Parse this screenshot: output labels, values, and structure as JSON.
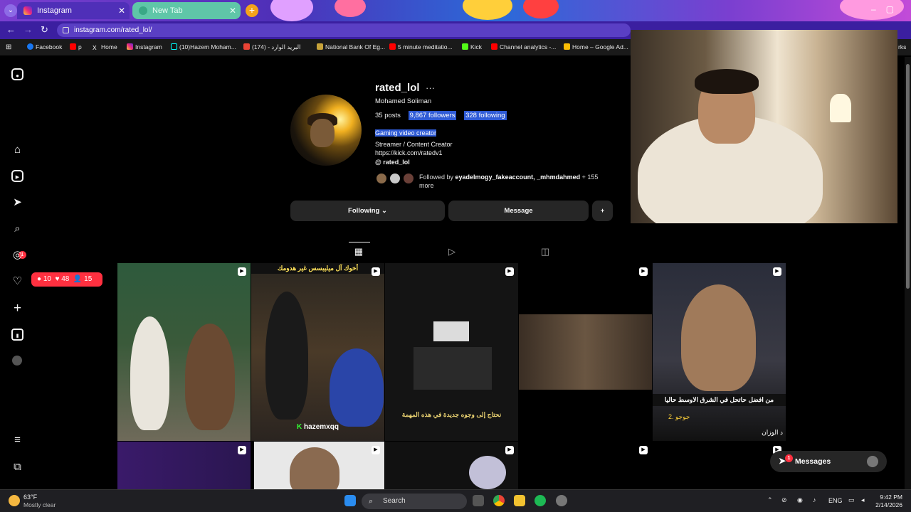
{
  "browser": {
    "tabs": [
      {
        "label": "Instagram",
        "active": true
      },
      {
        "label": "New Tab",
        "active": false
      }
    ],
    "url": "instagram.com/rated_lol/",
    "bookmarks": [
      "Facebook",
      "p",
      "Home",
      "Instagram",
      "(10)Hazem Moham...",
      "(174) - البريد الوارد",
      "National Bank Of Eg...",
      "5 minute meditatio...",
      "Kick",
      "Channel analytics -...",
      "Home – Google Ad...",
      "rks"
    ]
  },
  "sidebar": {
    "items": [
      "instagram-logo",
      "home",
      "reels",
      "messages",
      "search",
      "explore",
      "notifications",
      "create",
      "dashboard",
      "profile",
      "more",
      "also-from-meta"
    ],
    "messages_badge": "1",
    "notification_popup": {
      "comments": "10",
      "likes": "48",
      "follows": "15"
    }
  },
  "profile": {
    "username": "rated_lol",
    "more_dots": "···",
    "full_name": "Mohamed Soliman",
    "posts": "35 posts",
    "followers": "9,867 followers",
    "following": "328 following",
    "category": "Gaming video creator",
    "bio_line1": "Streamer / Content Creator",
    "bio_line2": "https://kick.com/ratedv1",
    "threads": "rated_lol",
    "followed_by_prefix": "Followed by ",
    "followed_by_names": "eyadelmogy_fakeaccount, _mhmdahmed",
    "followed_by_suffix": " + 155 more",
    "following_button": "Following ⌄",
    "message_button": "Message",
    "suggest_icon": "+person"
  },
  "grid": {
    "captions": {
      "t2_top": "أخوك آل ميليبسس غير هدومك",
      "t2_watermark": "hazemxqq",
      "t3_sub": "نحتاج إلى وجوه جديدة في هذه المهمة",
      "t5_q": "من افضل حاتحل في الشرق الاوسط حاليا",
      "t5_a1": "2. جوجو",
      "t5_a2": "د الوزان"
    }
  },
  "messages_pill": {
    "label": "Messages",
    "badge": "1"
  },
  "taskbar": {
    "weather_temp": "63°F",
    "weather_desc": "Mostly clear",
    "search": "Search",
    "lang": "ENG",
    "time": "9:42 PM",
    "date": "2/14/2026"
  },
  "colors": {
    "accent": "#0095f6",
    "badge": "#ff3040",
    "highlight": "#2f5bd6"
  }
}
